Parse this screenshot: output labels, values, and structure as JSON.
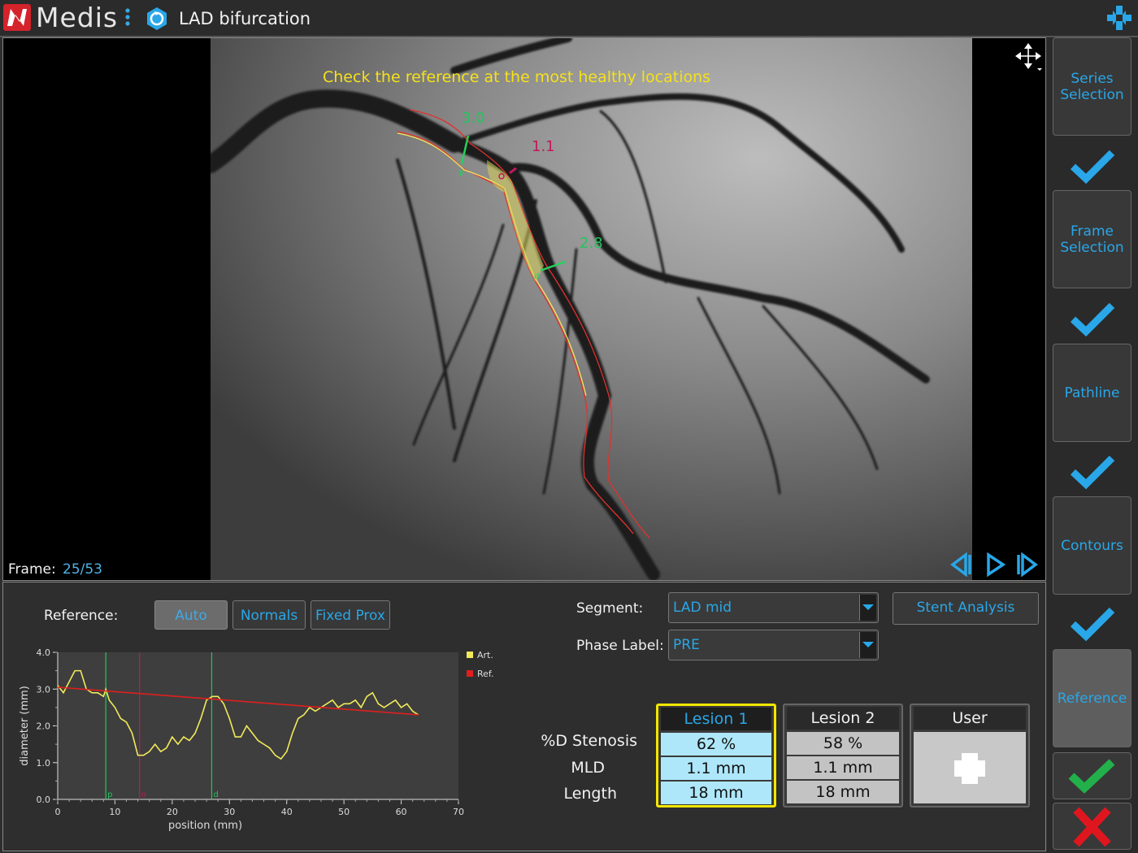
{
  "app": {
    "logo_text": "Medis",
    "title": "LAD bifurcation",
    "accent_color": "#29a7e8",
    "brand_color": "#d4232b"
  },
  "viewport": {
    "instruction": "Check the reference at the most healthy locations",
    "frame_label": "Frame:",
    "frame_value": "25/53",
    "annotations": {
      "prox_diameter": "3.0",
      "mld": "1.1",
      "dist_diameter": "2.8",
      "marker_p": "p",
      "marker_o": "o",
      "marker_d": "d"
    },
    "icons": [
      "move-icon",
      "step-back-icon",
      "play-icon",
      "step-forward-icon"
    ]
  },
  "reference": {
    "label": "Reference:",
    "buttons": [
      {
        "label": "Auto",
        "selected": true
      },
      {
        "label": "Normals",
        "selected": false
      },
      {
        "label": "Fixed Prox",
        "selected": false
      }
    ]
  },
  "form": {
    "segment_label": "Segment:",
    "segment_value": "LAD mid",
    "phase_label": "Phase Label:",
    "phase_value": "PRE",
    "stent_button": "Stent Analysis"
  },
  "results": {
    "row_labels": [
      "%D Stenosis",
      "MLD",
      "Length"
    ],
    "lesions": [
      {
        "name": "Lesion 1",
        "stenosis": "62 %",
        "mld": "1.1 mm",
        "length": "18 mm",
        "selected": true
      },
      {
        "name": "Lesion 2",
        "stenosis": "58 %",
        "mld": "1.1 mm",
        "length": "18 mm",
        "selected": false
      }
    ],
    "user_label": "User"
  },
  "sidebar": {
    "steps": [
      {
        "label_1": "Series",
        "label_2": "Selection",
        "done": true
      },
      {
        "label_1": "Frame",
        "label_2": "Selection",
        "done": true
      },
      {
        "label_1": "Pathline",
        "label_2": "",
        "done": true
      },
      {
        "label_1": "Contours",
        "label_2": "",
        "done": true
      },
      {
        "label_1": "Reference",
        "label_2": "",
        "active": true
      }
    ],
    "accept_color": "#22b04a",
    "reject_color": "#e0161e"
  },
  "chart_data": {
    "type": "line",
    "xlabel": "position (mm)",
    "ylabel": "diameter (mm)",
    "xlim": [
      0,
      70
    ],
    "ylim": [
      0,
      4.0
    ],
    "xticks": [
      0,
      10,
      20,
      30,
      40,
      50,
      60,
      70
    ],
    "yticks": [
      "0.0",
      "1.0",
      "2.0",
      "3.0",
      "4.0"
    ],
    "legend": [
      {
        "name": "Art.",
        "color": "#f1ea5a"
      },
      {
        "name": "Ref.",
        "color": "#e01e1e"
      }
    ],
    "legend_position": "right",
    "markers": [
      {
        "label": "p",
        "x": 8.4,
        "color": "#22c55e"
      },
      {
        "label": "o",
        "x": 14.3,
        "color": "#c2185b"
      },
      {
        "label": "d",
        "x": 26.9,
        "color": "#22c55e"
      }
    ],
    "series": [
      {
        "name": "Art.",
        "color": "#f1ea5a",
        "x": [
          0,
          1,
          2,
          3,
          4,
          5,
          6,
          7,
          8,
          8.4,
          9,
          10,
          11,
          12,
          13,
          14,
          15,
          16,
          17,
          18,
          19,
          20,
          21,
          22,
          23,
          24,
          25,
          26,
          27,
          28,
          29,
          30,
          31,
          32,
          33,
          34,
          35,
          36,
          37,
          38,
          39,
          40,
          41,
          42,
          43,
          44,
          45,
          46,
          47,
          48,
          49,
          50,
          51,
          52,
          53,
          54,
          55,
          56,
          57,
          58,
          59,
          60,
          61,
          62,
          63
        ],
        "y": [
          3.1,
          2.9,
          3.2,
          3.5,
          3.5,
          3.0,
          2.9,
          2.9,
          2.8,
          3.0,
          2.7,
          2.5,
          2.2,
          2.1,
          1.8,
          1.2,
          1.2,
          1.3,
          1.5,
          1.3,
          1.4,
          1.7,
          1.5,
          1.7,
          1.6,
          1.8,
          2.2,
          2.7,
          2.8,
          2.8,
          2.6,
          2.2,
          1.7,
          1.7,
          2.0,
          1.8,
          1.6,
          1.5,
          1.4,
          1.2,
          1.1,
          1.3,
          1.8,
          2.2,
          2.3,
          2.5,
          2.4,
          2.5,
          2.6,
          2.7,
          2.5,
          2.6,
          2.6,
          2.7,
          2.5,
          2.8,
          2.9,
          2.6,
          2.5,
          2.6,
          2.7,
          2.5,
          2.6,
          2.4,
          2.3
        ]
      },
      {
        "name": "Ref.",
        "color": "#e01e1e",
        "x": [
          0,
          63
        ],
        "y": [
          3.05,
          2.3
        ]
      }
    ]
  }
}
